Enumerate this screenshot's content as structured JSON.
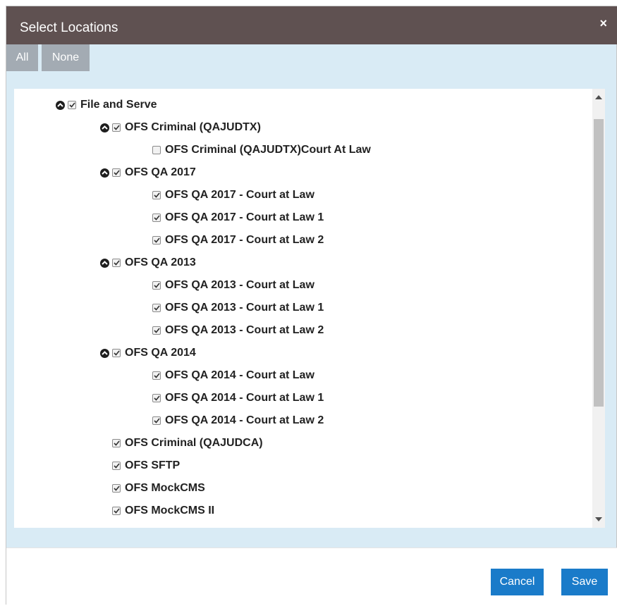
{
  "dialog": {
    "title": "Select Locations",
    "close_symbol": "×"
  },
  "toolbar": {
    "all_label": "All",
    "none_label": "None"
  },
  "tree": [
    {
      "label": "File and Serve",
      "level": 0,
      "expandable": true,
      "checked": true
    },
    {
      "label": "OFS Criminal (QAJUDTX)",
      "level": 1,
      "expandable": true,
      "checked": true
    },
    {
      "label": "OFS Criminal (QAJUDTX)Court At Law",
      "level": 2,
      "expandable": false,
      "checked": false
    },
    {
      "label": "OFS QA 2017",
      "level": 1,
      "expandable": true,
      "checked": true
    },
    {
      "label": "OFS QA 2017 - Court at Law",
      "level": 2,
      "expandable": false,
      "checked": true
    },
    {
      "label": "OFS QA 2017 - Court at Law 1",
      "level": 2,
      "expandable": false,
      "checked": true
    },
    {
      "label": "OFS QA 2017 - Court at Law 2",
      "level": 2,
      "expandable": false,
      "checked": true
    },
    {
      "label": "OFS QA 2013",
      "level": 1,
      "expandable": true,
      "checked": true
    },
    {
      "label": "OFS QA 2013 - Court at Law",
      "level": 2,
      "expandable": false,
      "checked": true
    },
    {
      "label": "OFS QA 2013 - Court at Law 1",
      "level": 2,
      "expandable": false,
      "checked": true
    },
    {
      "label": "OFS QA 2013 - Court at Law 2",
      "level": 2,
      "expandable": false,
      "checked": true
    },
    {
      "label": "OFS QA 2014",
      "level": 1,
      "expandable": true,
      "checked": true
    },
    {
      "label": "OFS QA 2014 - Court at Law",
      "level": 2,
      "expandable": false,
      "checked": true
    },
    {
      "label": "OFS QA 2014 - Court at Law 1",
      "level": 2,
      "expandable": false,
      "checked": true
    },
    {
      "label": "OFS QA 2014 - Court at Law 2",
      "level": 2,
      "expandable": false,
      "checked": true
    },
    {
      "label": "OFS Criminal (QAJUDCA)",
      "level": 1,
      "expandable": false,
      "checked": true
    },
    {
      "label": "OFS SFTP",
      "level": 1,
      "expandable": false,
      "checked": true
    },
    {
      "label": "OFS MockCMS",
      "level": 1,
      "expandable": false,
      "checked": true
    },
    {
      "label": "OFS MockCMS II",
      "level": 1,
      "expandable": false,
      "checked": true
    }
  ],
  "icons": {
    "toggle": "collapse-circle-icon",
    "checkbox": "checkbox-icon",
    "scroll_up": "scroll-up-arrow-icon",
    "scroll_down": "scroll-down-arrow-icon"
  },
  "footer": {
    "cancel_label": "Cancel",
    "save_label": "Save"
  },
  "colors": {
    "header_bg": "#5f5151",
    "body_bg": "#d9ebf5",
    "toolbar_button": "#a3abb3",
    "primary_button": "#1a7bc9"
  }
}
